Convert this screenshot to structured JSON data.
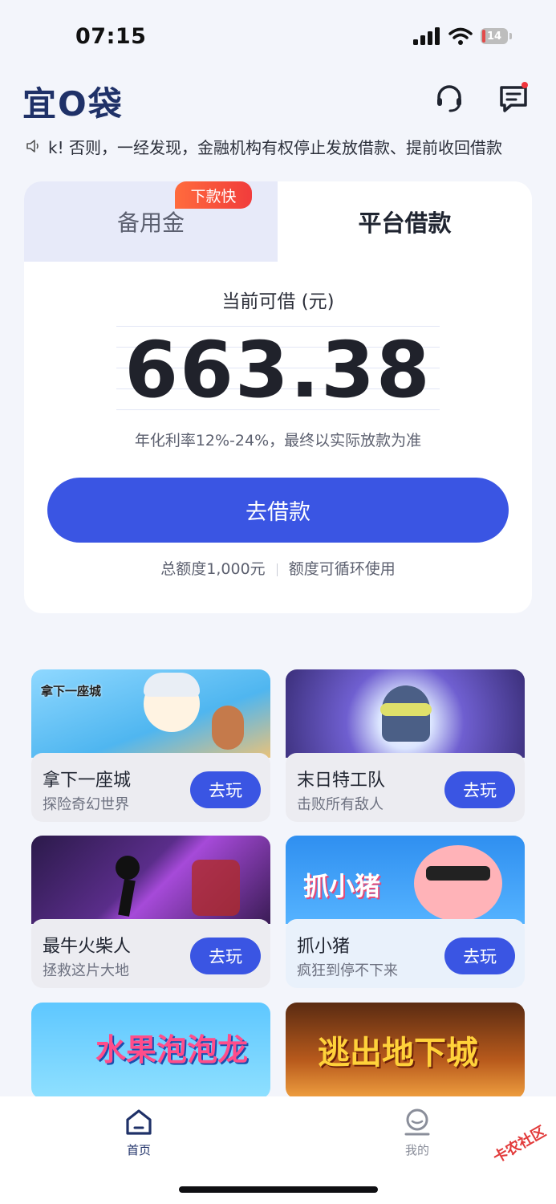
{
  "status_bar": {
    "time": "07:15",
    "battery": "14"
  },
  "header": {
    "app_name": "宜O袋"
  },
  "notice": {
    "text": "k! 否则，一经发现，金融机构有权停止发放借款、提前收回借款"
  },
  "loan_card": {
    "tab_left_label": "备用金",
    "tab_left_badge": "下款快",
    "tab_right_label": "平台借款",
    "available_label": "当前可借 (元)",
    "amount": "663.38",
    "rate_text": "年化利率12%-24%，最终以实际放款为准",
    "borrow_button": "去借款",
    "total_quota": "总额度1,000元",
    "quota_note": "额度可循环使用"
  },
  "games": [
    {
      "title": "拿下一座城",
      "subtitle": "探险奇幻世界",
      "image_text": "拿下一座城",
      "button": "去玩"
    },
    {
      "title": "末日特工队",
      "subtitle": "击败所有敌人",
      "button": "去玩"
    },
    {
      "title": "最牛火柴人",
      "subtitle": "拯救这片大地",
      "button": "去玩"
    },
    {
      "title": "抓小猪",
      "subtitle": "疯狂到停不下来",
      "image_text": "抓小猪",
      "button": "去玩"
    },
    {
      "image_text": "水果泡泡龙"
    },
    {
      "image_text": "逃出地下城"
    }
  ],
  "bottom_nav": {
    "home_label": "首页",
    "mine_label": "我的",
    "active_color": "#1f3168",
    "inactive_color": "#8a8e9a"
  },
  "watermark": {
    "text": "卡农社区"
  },
  "colors": {
    "primary": "#3a55e3",
    "badge": "#f13c3c",
    "logo": "#1f3168"
  }
}
